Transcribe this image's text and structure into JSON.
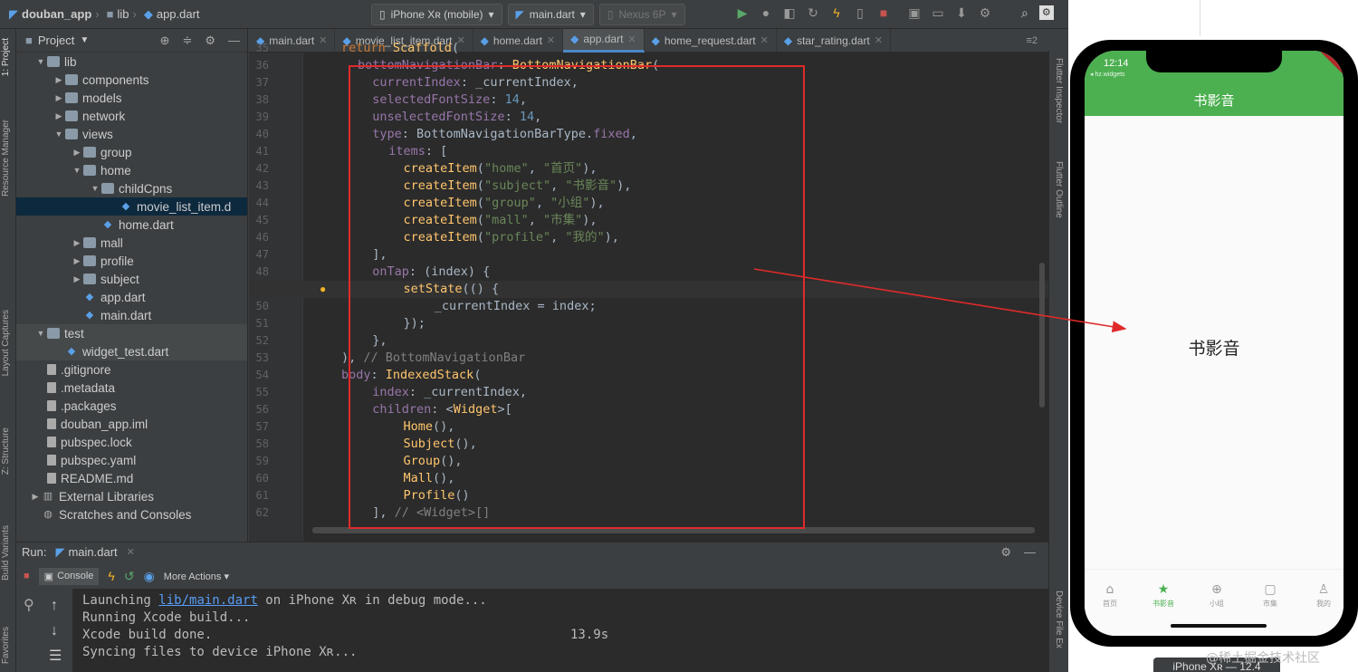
{
  "toolbar": {
    "project_name": "douban_app",
    "crumb_folder": "lib",
    "crumb_file": "app.dart",
    "device": "iPhone Xʀ (mobile)",
    "run_config": "main.dart",
    "emulator": "Nexus 6P"
  },
  "sidebar": {
    "project_label": "1: Project",
    "resource_label": "Resource Manager",
    "layout_label": "Layout Captures",
    "structure_label": "Z: Structure",
    "build_label": "Build Variants",
    "favorites_label": "Favorites"
  },
  "right_sidebar": {
    "inspector": "Flutter Inspector",
    "outline": "Flutter Outline",
    "device_file": "Device File Ex"
  },
  "project": {
    "title": "Project",
    "tree": [
      {
        "label": "lib",
        "depth": 0,
        "arrow": "▼",
        "icon": "folder"
      },
      {
        "label": "components",
        "depth": 1,
        "arrow": "▶",
        "icon": "folder"
      },
      {
        "label": "models",
        "depth": 1,
        "arrow": "▶",
        "icon": "folder"
      },
      {
        "label": "network",
        "depth": 1,
        "arrow": "▶",
        "icon": "folder"
      },
      {
        "label": "views",
        "depth": 1,
        "arrow": "▼",
        "icon": "folder"
      },
      {
        "label": "group",
        "depth": 2,
        "arrow": "▶",
        "icon": "folder"
      },
      {
        "label": "home",
        "depth": 2,
        "arrow": "▼",
        "icon": "folder"
      },
      {
        "label": "childCpns",
        "depth": 3,
        "arrow": "▼",
        "icon": "folder"
      },
      {
        "label": "movie_list_item.d",
        "depth": 4,
        "arrow": "",
        "icon": "dart",
        "selected": true
      },
      {
        "label": "home.dart",
        "depth": 3,
        "arrow": "",
        "icon": "dart"
      },
      {
        "label": "mall",
        "depth": 2,
        "arrow": "▶",
        "icon": "folder"
      },
      {
        "label": "profile",
        "depth": 2,
        "arrow": "▶",
        "icon": "folder"
      },
      {
        "label": "subject",
        "depth": 2,
        "arrow": "▶",
        "icon": "folder"
      },
      {
        "label": "app.dart",
        "depth": 2,
        "arrow": "",
        "icon": "dart"
      },
      {
        "label": "main.dart",
        "depth": 2,
        "arrow": "",
        "icon": "dart"
      },
      {
        "label": "test",
        "depth": 0,
        "arrow": "▼",
        "icon": "folder",
        "group": true
      },
      {
        "label": "widget_test.dart",
        "depth": 1,
        "arrow": "",
        "icon": "dart",
        "group": true
      },
      {
        "label": ".gitignore",
        "depth": 0,
        "arrow": "",
        "icon": "file"
      },
      {
        "label": ".metadata",
        "depth": 0,
        "arrow": "",
        "icon": "file"
      },
      {
        "label": ".packages",
        "depth": 0,
        "arrow": "",
        "icon": "file"
      },
      {
        "label": "douban_app.iml",
        "depth": 0,
        "arrow": "",
        "icon": "file"
      },
      {
        "label": "pubspec.lock",
        "depth": 0,
        "arrow": "",
        "icon": "file"
      },
      {
        "label": "pubspec.yaml",
        "depth": 0,
        "arrow": "",
        "icon": "file"
      },
      {
        "label": "README.md",
        "depth": 0,
        "arrow": "",
        "icon": "file"
      },
      {
        "label": "External Libraries",
        "depth": -1,
        "arrow": "▶",
        "icon": "lib"
      },
      {
        "label": "Scratches and Consoles",
        "depth": -1,
        "arrow": "",
        "icon": "scratch"
      }
    ]
  },
  "tabs": [
    {
      "label": "main.dart",
      "active": false
    },
    {
      "label": "movie_list_item.dart",
      "active": false
    },
    {
      "label": "home.dart",
      "active": false
    },
    {
      "label": "app.dart",
      "active": true
    },
    {
      "label": "home_request.dart",
      "active": false
    },
    {
      "label": "star_rating.dart",
      "active": false
    }
  ],
  "tabs_more": "≡2",
  "editor": {
    "first_line": 35,
    "highlight_line": 49,
    "lines": [
      [
        [
          "kw",
          "return "
        ],
        [
          "cls",
          "Scaffold"
        ],
        [
          "id",
          "("
        ]
      ],
      [
        [
          "fld",
          "bottomNavigationBar"
        ],
        [
          "id",
          ": "
        ],
        [
          "cls",
          "BottomNavigationBar"
        ],
        [
          "id",
          "("
        ]
      ],
      [
        [
          "id",
          "  "
        ],
        [
          "fld",
          "currentIndex"
        ],
        [
          "id",
          ": _currentIndex,"
        ]
      ],
      [
        [
          "id",
          "  "
        ],
        [
          "fld",
          "selectedFontSize"
        ],
        [
          "id",
          ": "
        ],
        [
          "num",
          "14"
        ],
        [
          "id",
          ","
        ]
      ],
      [
        [
          "id",
          "  "
        ],
        [
          "fld",
          "unselectedFontSize"
        ],
        [
          "id",
          ": "
        ],
        [
          "num",
          "14"
        ],
        [
          "id",
          ","
        ]
      ],
      [
        [
          "id",
          "  "
        ],
        [
          "fld",
          "type"
        ],
        [
          "id",
          ": BottomNavigationBarType."
        ],
        [
          "fld",
          "fixed"
        ],
        [
          "id",
          ","
        ]
      ],
      [
        [
          "id",
          "  "
        ],
        [
          "fld",
          "items"
        ],
        [
          "id",
          ": ["
        ]
      ],
      [
        [
          "id",
          "    "
        ],
        [
          "cls",
          "createItem"
        ],
        [
          "id",
          "("
        ],
        [
          "str",
          "\"home\""
        ],
        [
          "id",
          ", "
        ],
        [
          "str",
          "\"首页\""
        ],
        [
          "id",
          "),"
        ]
      ],
      [
        [
          "id",
          "    "
        ],
        [
          "cls",
          "createItem"
        ],
        [
          "id",
          "("
        ],
        [
          "str",
          "\"subject\""
        ],
        [
          "id",
          ", "
        ],
        [
          "str",
          "\"书影音\""
        ],
        [
          "id",
          "),"
        ]
      ],
      [
        [
          "id",
          "    "
        ],
        [
          "cls",
          "createItem"
        ],
        [
          "id",
          "("
        ],
        [
          "str",
          "\"group\""
        ],
        [
          "id",
          ", "
        ],
        [
          "str",
          "\"小组\""
        ],
        [
          "id",
          "),"
        ]
      ],
      [
        [
          "id",
          "    "
        ],
        [
          "cls",
          "createItem"
        ],
        [
          "id",
          "("
        ],
        [
          "str",
          "\"mall\""
        ],
        [
          "id",
          ", "
        ],
        [
          "str",
          "\"市集\""
        ],
        [
          "id",
          "),"
        ]
      ],
      [
        [
          "id",
          "    "
        ],
        [
          "cls",
          "createItem"
        ],
        [
          "id",
          "("
        ],
        [
          "str",
          "\"profile\""
        ],
        [
          "id",
          ", "
        ],
        [
          "str",
          "\"我的\""
        ],
        [
          "id",
          "),"
        ]
      ],
      [
        [
          "id",
          "  ],"
        ]
      ],
      [
        [
          "id",
          "  "
        ],
        [
          "fld",
          "onTap"
        ],
        [
          "id",
          ": (index) {"
        ]
      ],
      [
        [
          "id",
          "    "
        ],
        [
          "cls",
          "setState"
        ],
        [
          "id",
          "(() {"
        ]
      ],
      [
        [
          "id",
          "      _currentIndex = index;"
        ]
      ],
      [
        [
          "id",
          "    });"
        ]
      ],
      [
        [
          "id",
          "  },"
        ]
      ],
      [
        [
          "id",
          "), "
        ],
        [
          "cm",
          "// BottomNavigationBar"
        ]
      ],
      [
        [
          "fld",
          "body"
        ],
        [
          "id",
          ": "
        ],
        [
          "cls",
          "IndexedStack"
        ],
        [
          "id",
          "("
        ]
      ],
      [
        [
          "id",
          "  "
        ],
        [
          "fld",
          "index"
        ],
        [
          "id",
          ": _currentIndex,"
        ]
      ],
      [
        [
          "id",
          "  "
        ],
        [
          "fld",
          "children"
        ],
        [
          "id",
          ": <"
        ],
        [
          "cls",
          "Widget"
        ],
        [
          "id",
          ">["
        ]
      ],
      [
        [
          "id",
          "    "
        ],
        [
          "cls",
          "Home"
        ],
        [
          "id",
          "(),"
        ]
      ],
      [
        [
          "id",
          "    "
        ],
        [
          "cls",
          "Subject"
        ],
        [
          "id",
          "(),"
        ]
      ],
      [
        [
          "id",
          "    "
        ],
        [
          "cls",
          "Group"
        ],
        [
          "id",
          "(),"
        ]
      ],
      [
        [
          "id",
          "    "
        ],
        [
          "cls",
          "Mall"
        ],
        [
          "id",
          "(),"
        ]
      ],
      [
        [
          "id",
          "    "
        ],
        [
          "cls",
          "Profile"
        ],
        [
          "id",
          "()"
        ]
      ],
      [
        [
          "id",
          "  ], "
        ],
        [
          "cm",
          "// <Widget>[]"
        ]
      ]
    ]
  },
  "run": {
    "label": "Run:",
    "config": "main.dart",
    "console_tab": "Console",
    "more_actions": "More Actions",
    "line1_pre": "Launching ",
    "line1_link": "lib/main.dart",
    "line1_post": " on iPhone Xʀ in debug mode...",
    "line2": "Running Xcode build...",
    "line3": "Xcode build done.",
    "line3_time": "13.9s",
    "line4": "Syncing files to device iPhone Xʀ..."
  },
  "phone": {
    "time": "12:14",
    "back_label": "◂ hz.widgets",
    "debug_banner": "DEBUG",
    "app_title": "书影音",
    "body_text": "书影音",
    "nav": [
      {
        "label": "首页",
        "icon": "⌂",
        "active": false
      },
      {
        "label": "书影音",
        "icon": "★",
        "active": true
      },
      {
        "label": "小组",
        "icon": "⊕",
        "active": false
      },
      {
        "label": "市集",
        "icon": "▢",
        "active": false
      },
      {
        "label": "我的",
        "icon": "♙",
        "active": false
      }
    ],
    "device_label": "iPhone Xʀ — 12.4"
  },
  "watermark": "@稀土掘金技术社区",
  "colors": {
    "accent_green": "#4caf50",
    "annotation_red": "#e02a2a"
  }
}
